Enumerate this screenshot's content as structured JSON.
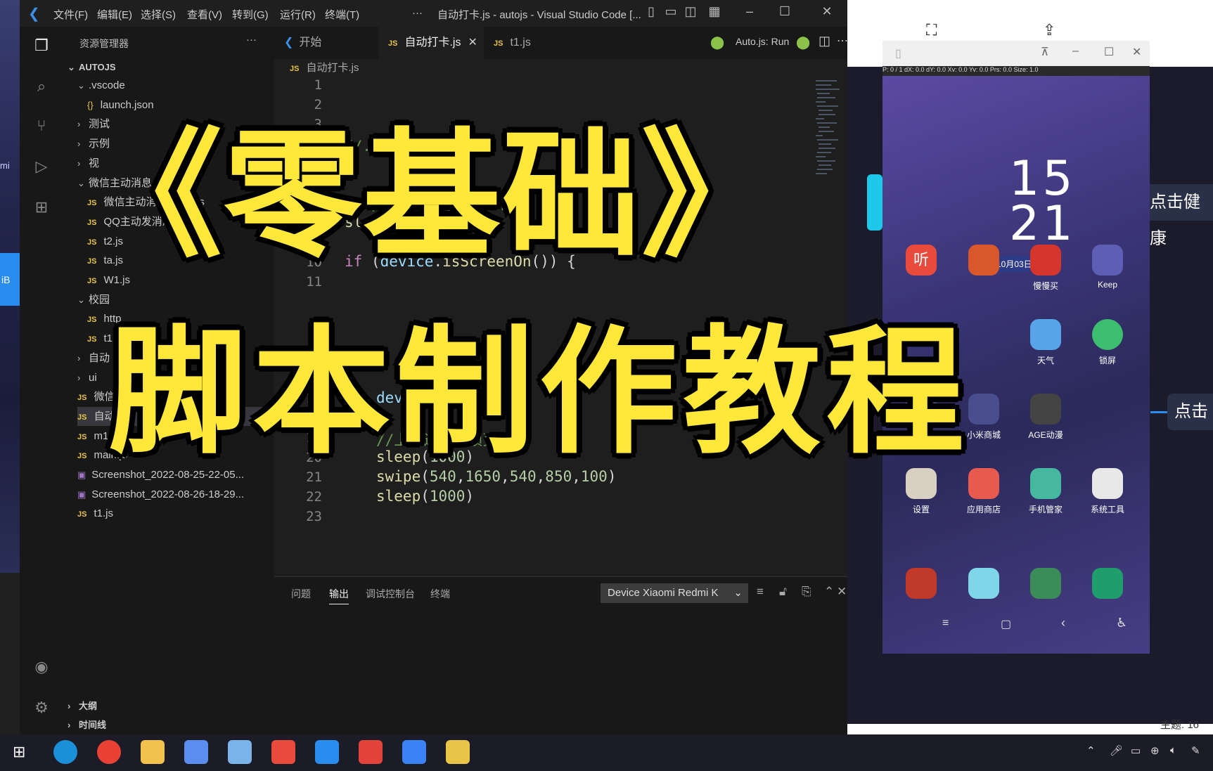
{
  "vscode": {
    "menu": [
      "文件(F)",
      "编辑(E)",
      "选择(S)",
      "查看(V)",
      "转到(G)",
      "运行(R)",
      "终端(T)",
      "···"
    ],
    "window_title": "自动打卡.js - autojs - Visual Studio Code [...",
    "explorer_title": "资源管理器",
    "explorer_more": "···",
    "project": "AUTOJS",
    "tree": [
      {
        "label": ".vscode",
        "kind": "folder-open"
      },
      {
        "label": "launch.json",
        "kind": "json"
      },
      {
        "label": "测试",
        "kind": "folder"
      },
      {
        "label": "示例",
        "kind": "folder"
      },
      {
        "label": "视",
        "kind": "folder"
      },
      {
        "label": "微信主动消息",
        "kind": "folder-open"
      },
      {
        "label": "微信主动消息_源码.js",
        "kind": "js"
      },
      {
        "label": "QQ主动发消息_源码.js",
        "kind": "js"
      },
      {
        "label": "t2.js",
        "kind": "js"
      },
      {
        "label": "ta.js",
        "kind": "js"
      },
      {
        "label": "W1.js",
        "kind": "js"
      },
      {
        "label": "校园",
        "kind": "folder-open"
      },
      {
        "label": "http",
        "kind": "js"
      },
      {
        "label": "t1.js",
        "kind": "js"
      },
      {
        "label": "自动",
        "kind": "folder"
      },
      {
        "label": "ui",
        "kind": "folder"
      },
      {
        "label": "微信",
        "kind": "js"
      },
      {
        "label": "自动",
        "kind": "js"
      },
      {
        "label": "m1.js",
        "kind": "js"
      },
      {
        "label": "main.js",
        "kind": "js"
      },
      {
        "label": "Screenshot_2022-08-25-22-05...",
        "kind": "img"
      },
      {
        "label": "Screenshot_2022-08-26-18-29...",
        "kind": "img"
      },
      {
        "label": "t1.js",
        "kind": "js"
      }
    ],
    "outline": "大纲",
    "timeline": "时间线",
    "tabs": [
      {
        "label": "开始",
        "icon": "vscode-icon"
      },
      {
        "label": "自动打卡.js",
        "icon": "JS",
        "active": true
      },
      {
        "label": "t1.js",
        "icon": "JS"
      }
    ],
    "run_label": "Auto.js: Run",
    "breadcrumb": "自动打卡.js",
    "js_badge": "JS",
    "code_lines": [
      {
        "n": "1",
        "text": ""
      },
      {
        "n": "2",
        "text": ""
      },
      {
        "n": "3",
        "text": ""
      },
      {
        "n": "4",
        "text": "//...滑动、输入文本"
      },
      {
        "n": "5",
        "text": ""
      },
      {
        "n": "6",
        "text": ""
      },
      {
        "n": "7",
        "text": "// 判断屏幕是否亮屏...锁"
      },
      {
        "n": "8",
        "text": "sleep(2000)"
      },
      {
        "n": "9",
        "text": ""
      },
      {
        "n": "10",
        "text": "if (device.isScreenOn()) {"
      },
      {
        "n": "11",
        "text": ""
      },
      {
        "n": "17",
        "text": "device.wakeUp()"
      },
      {
        "n": "18",
        "text": ""
      },
      {
        "n": "19",
        "text": "//上滑进入解锁页面"
      },
      {
        "n": "20",
        "text": "sleep(1000)"
      },
      {
        "n": "21",
        "text": "swipe(540,1650,540,850,100)"
      },
      {
        "n": "22",
        "text": "sleep(1000)"
      },
      {
        "n": "23",
        "text": ""
      }
    ],
    "panel_tabs": [
      "问题",
      "输出",
      "调试控制台",
      "终端"
    ],
    "device_select": "Device Xiaomi Redmi K"
  },
  "overlay": {
    "line1": "《零基础》",
    "line2": "脚本制作教程"
  },
  "phone": {
    "status": "P: 0 / 1    dX: 0.0    dY: 0.0    Xv: 0.0    Yv: 0.0    Prs: 0.0    Size: 1.0",
    "clock": "15\n21",
    "date": "10月03日 周一",
    "apps_row1": [
      "听",
      "",
      "慢慢买",
      "Keep"
    ],
    "apps_row2": [
      "天气",
      "锁屏"
    ],
    "apps_row3": [
      "小米视频",
      "小米商城",
      "AGE动漫"
    ],
    "apps_row4": [
      "设置",
      "应用商店",
      "手机管家",
      "系统工具"
    ]
  },
  "right": {
    "callout1": "点击健康",
    "callout2": "点击",
    "theme": "主题: 16"
  },
  "left_strip": {
    "mi": "mi",
    "blue": "iB"
  },
  "colors": {
    "overlay_yellow": "#ffe83a",
    "vscode_bg": "#1e1e1e",
    "js_yellow": "#e8c547"
  }
}
